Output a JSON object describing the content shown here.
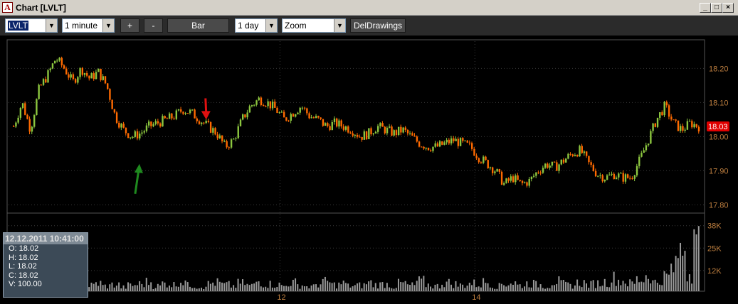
{
  "window": {
    "app_icon": "A",
    "title": "Chart [LVLT]",
    "min_icon": "_",
    "max_icon": "□",
    "close_icon": "×"
  },
  "toolbar": {
    "symbol": "LVLT",
    "interval": "1 minute",
    "plus_label": "+",
    "minus_label": "-",
    "bar_label": "Bar",
    "period": "1 day",
    "mode": "Zoom",
    "del_label": "DelDrawings"
  },
  "info_panel": {
    "timestamp": "12.12.2011 10:41:00",
    "open": "O: 18.02",
    "high": "H: 18.02",
    "low": "L: 18.02",
    "close": "C: 18.02",
    "volume": "V: 100.00"
  },
  "chart_data": {
    "type": "candlestick",
    "price_ticks": [
      18.2,
      18.1,
      18.0,
      17.9,
      17.8
    ],
    "price_tick_labels": [
      "18.20",
      "18.10",
      "18.00",
      "17.90",
      "17.80"
    ],
    "price_range": [
      17.78,
      18.28
    ],
    "last_price": 18.03,
    "last_price_label": "18.03",
    "volume_ticks": [
      38000,
      25000,
      12000
    ],
    "volume_tick_labels": [
      "38K",
      "25K",
      "12K"
    ],
    "volume_range": [
      0,
      42000
    ],
    "x_tick_labels": [
      "12",
      "14"
    ],
    "x_tick_positions": [
      0.39,
      0.67
    ],
    "price_path": [
      18.03,
      18.1,
      18.02,
      18.14,
      18.18,
      18.23,
      18.2,
      18.16,
      18.2,
      18.17,
      18.19,
      18.15,
      18.06,
      18.02,
      18.0,
      18.01,
      18.03,
      18.04,
      18.05,
      18.06,
      18.08,
      18.07,
      18.05,
      18.03,
      18.01,
      17.97,
      17.99,
      18.05,
      18.09,
      18.11,
      18.1,
      18.08,
      18.05,
      18.07,
      18.09,
      18.06,
      18.05,
      18.03,
      18.04,
      18.03,
      18.02,
      18.0,
      18.01,
      18.03,
      18.02,
      18.01,
      18.02,
      18.0,
      17.98,
      17.97,
      17.97,
      17.98,
      17.99,
      17.98,
      17.97,
      17.94,
      17.92,
      17.9,
      17.86,
      17.88,
      17.86,
      17.87,
      17.9,
      17.92,
      17.91,
      17.93,
      17.95,
      17.96,
      17.92,
      17.89,
      17.88,
      17.89,
      17.88,
      17.88,
      17.93,
      17.99,
      18.05,
      18.09,
      18.04,
      18.02,
      18.04,
      18.03
    ],
    "volume_heights": [
      0.1,
      0.12,
      0.08,
      0.15,
      0.09,
      0.11,
      0.07,
      0.13,
      0.1,
      0.09,
      0.12,
      0.08,
      0.1,
      0.06,
      0.09,
      0.11,
      0.14,
      0.08,
      0.12,
      0.1,
      0.16,
      0.09,
      0.07,
      0.11,
      0.13,
      0.1,
      0.08,
      0.12,
      0.09,
      0.15,
      0.11,
      0.1,
      0.08,
      0.13,
      0.09,
      0.07,
      0.11,
      0.14,
      0.1,
      0.12,
      0.08,
      0.09,
      0.13,
      0.1,
      0.11,
      0.07,
      0.12,
      0.09,
      0.15,
      0.1,
      0.08,
      0.13,
      0.11,
      0.09,
      0.12,
      0.1,
      0.14,
      0.08,
      0.11,
      0.13,
      0.09,
      0.12,
      0.1,
      0.08,
      0.15,
      0.11,
      0.09,
      0.13,
      0.1,
      0.12,
      0.14,
      0.2,
      0.16,
      0.12,
      0.18,
      0.25,
      0.14,
      0.22,
      0.35,
      0.6,
      0.28,
      0.95
    ],
    "annotations": [
      {
        "type": "up-arrow",
        "color": "#1f8a1f",
        "x_frac": 0.185,
        "price": 17.92
      },
      {
        "type": "down-arrow",
        "color": "#e01010",
        "x_frac": 0.283,
        "price": 18.05
      }
    ],
    "colors": {
      "up": "#8cc63f",
      "down": "#ff6a00",
      "volume": "#9a9a9a",
      "axis_text": "#c08040",
      "grid": "#3a3a3a",
      "last_price_bg": "#e00000"
    },
    "grid": true
  }
}
